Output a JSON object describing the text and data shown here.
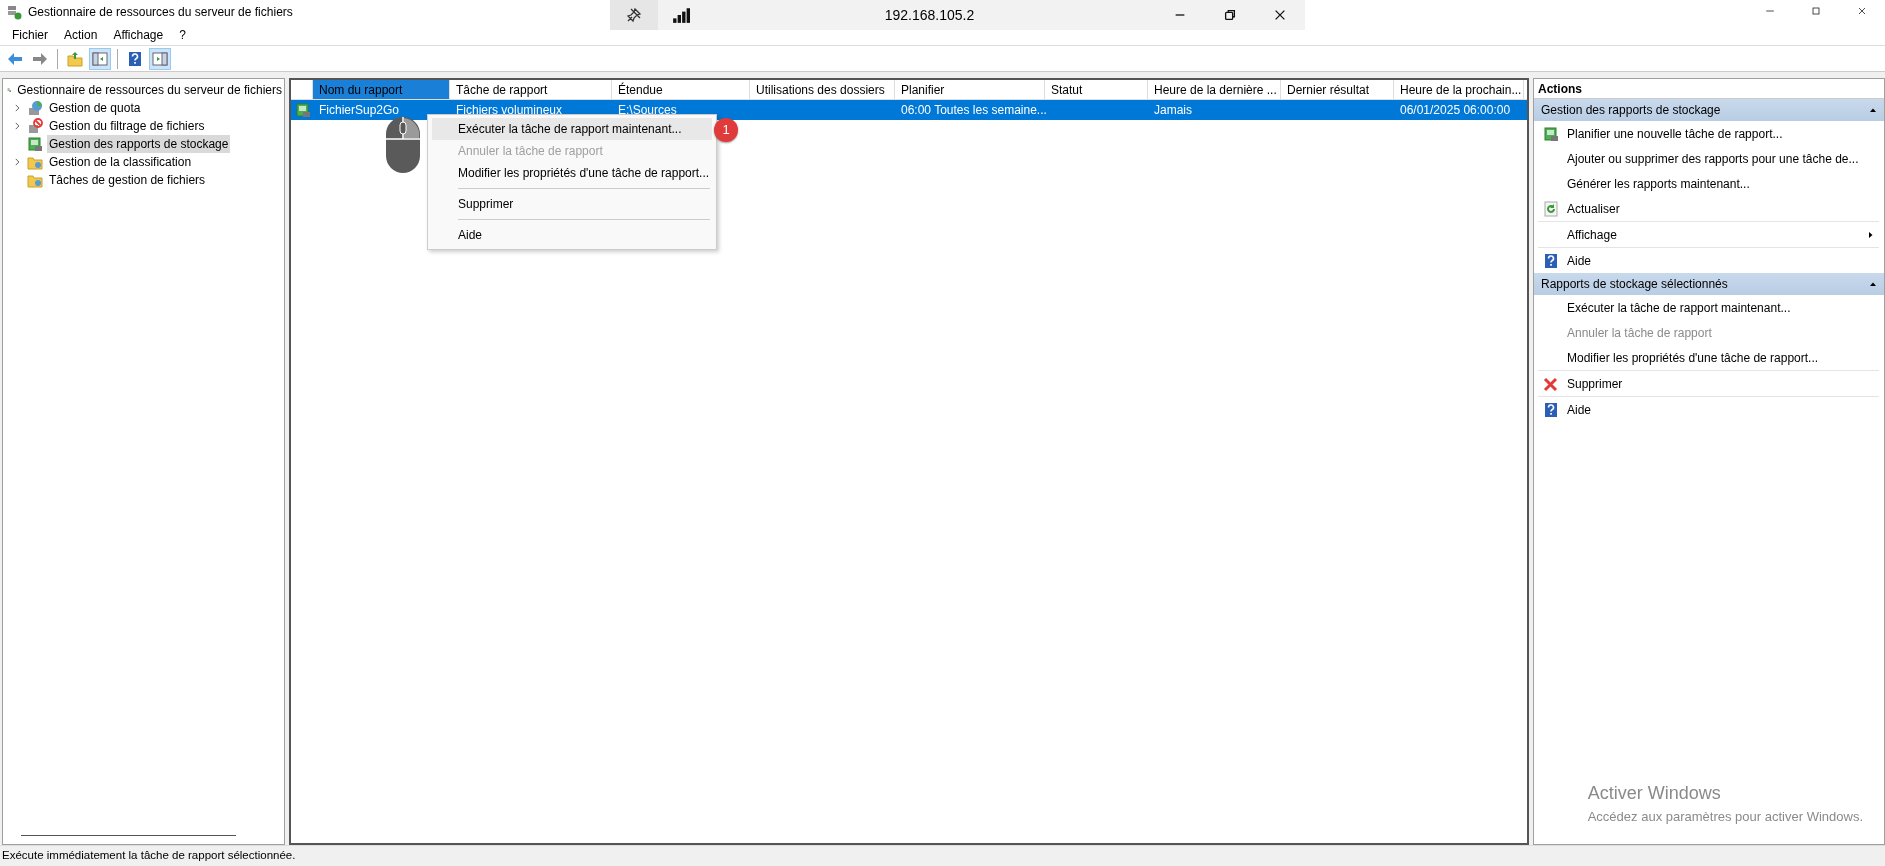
{
  "window": {
    "title": "Gestionnaire de ressources du serveur de fichiers"
  },
  "remote_bar": {
    "address": "192.168.105.2"
  },
  "menu": [
    "Fichier",
    "Action",
    "Affichage",
    "?"
  ],
  "toolbar": [
    {
      "kind": "back",
      "pressed": false
    },
    {
      "kind": "forward",
      "pressed": false
    },
    {
      "kind": "sep"
    },
    {
      "kind": "folder-up",
      "pressed": false
    },
    {
      "kind": "pane",
      "pressed": true
    },
    {
      "kind": "sep"
    },
    {
      "kind": "help",
      "pressed": false
    },
    {
      "kind": "pane-right",
      "pressed": true
    }
  ],
  "tree": {
    "label": "Gestionnaire de ressources du serveur de fichiers",
    "children": [
      {
        "label": "Gestion de quota",
        "kind": "branch",
        "expanded": false,
        "selected": false
      },
      {
        "label": "Gestion du filtrage de fichiers",
        "kind": "branch",
        "expanded": false,
        "selected": false
      },
      {
        "label": "Gestion des rapports de stockage",
        "kind": "leaf",
        "selected": true
      },
      {
        "label": "Gestion de la classification",
        "kind": "branch",
        "expanded": false,
        "selected": false
      },
      {
        "label": "Tâches de gestion de fichiers",
        "kind": "leaf",
        "selected": false
      }
    ]
  },
  "table": {
    "columns": [
      {
        "label": "Nom du rapport",
        "selected": true
      },
      {
        "label": "Tâche de rapport",
        "selected": false
      },
      {
        "label": "Étendue",
        "selected": false
      },
      {
        "label": "Utilisations des dossiers",
        "selected": false
      },
      {
        "label": "Planifier",
        "selected": false
      },
      {
        "label": "Statut",
        "selected": false
      },
      {
        "label": "Heure de la dernière ...",
        "selected": false
      },
      {
        "label": "Dernier résultat",
        "selected": false
      },
      {
        "label": "Heure de la prochain...",
        "selected": false
      }
    ],
    "rows": [
      {
        "selected": true,
        "cells": [
          "FichierSup2Go",
          "Fichiers volumineux",
          "E:\\Sources",
          "",
          "06:00 Toutes les semaine...",
          "",
          "Jamais",
          "",
          "06/01/2025 06:00:00"
        ]
      }
    ]
  },
  "context_menu": {
    "badge": "1",
    "items": [
      {
        "kind": "item",
        "label": "Exécuter la tâche de rapport maintenant...",
        "disabled": false,
        "selected": true
      },
      {
        "kind": "item",
        "label": "Annuler la tâche de rapport",
        "disabled": true,
        "selected": false
      },
      {
        "kind": "item",
        "label": "Modifier les propriétés d'une tâche de rapport...",
        "disabled": false,
        "selected": false
      },
      {
        "kind": "separator"
      },
      {
        "kind": "item",
        "label": "Supprimer",
        "disabled": false,
        "selected": false
      },
      {
        "kind": "separator"
      },
      {
        "kind": "item",
        "label": "Aide",
        "disabled": false,
        "selected": false
      }
    ]
  },
  "actions": {
    "title": "Actions",
    "sections": [
      {
        "title": "Gestion des rapports de stockage",
        "expanded": true,
        "items": [
          {
            "kind": "report",
            "label": "Planifier une nouvelle tâche de rapport...",
            "disabled": false,
            "submenu": false
          },
          {
            "kind": "plain",
            "label": "Ajouter ou supprimer des rapports pour une tâche de...",
            "disabled": false,
            "submenu": false
          },
          {
            "kind": "plain",
            "label": "Générer les rapports maintenant...",
            "disabled": false,
            "submenu": false
          },
          {
            "kind": "refresh",
            "label": "Actualiser",
            "disabled": false,
            "submenu": false
          },
          {
            "kind": "separator"
          },
          {
            "kind": "plain",
            "label": "Affichage",
            "disabled": false,
            "submenu": true
          },
          {
            "kind": "separator"
          },
          {
            "kind": "help",
            "label": "Aide",
            "disabled": false,
            "submenu": false
          }
        ]
      },
      {
        "title": "Rapports de stockage sélectionnés",
        "expanded": true,
        "items": [
          {
            "kind": "plain",
            "label": "Exécuter la tâche de rapport maintenant...",
            "disabled": false,
            "submenu": false
          },
          {
            "kind": "plain",
            "label": "Annuler la tâche de rapport",
            "disabled": true,
            "submenu": false
          },
          {
            "kind": "plain",
            "label": "Modifier les propriétés d'une tâche de rapport...",
            "disabled": false,
            "submenu": false
          },
          {
            "kind": "separator"
          },
          {
            "kind": "delete",
            "label": "Supprimer",
            "disabled": false,
            "submenu": false
          },
          {
            "kind": "separator"
          },
          {
            "kind": "help",
            "label": "Aide",
            "disabled": false,
            "submenu": false
          }
        ]
      }
    ]
  },
  "activation": {
    "title": "Activer Windows",
    "text": "Accédez aux paramètres pour activer Windows."
  },
  "status_bar": {
    "text": "Exécute immédiatement la tâche de rapport sélectionnée."
  }
}
